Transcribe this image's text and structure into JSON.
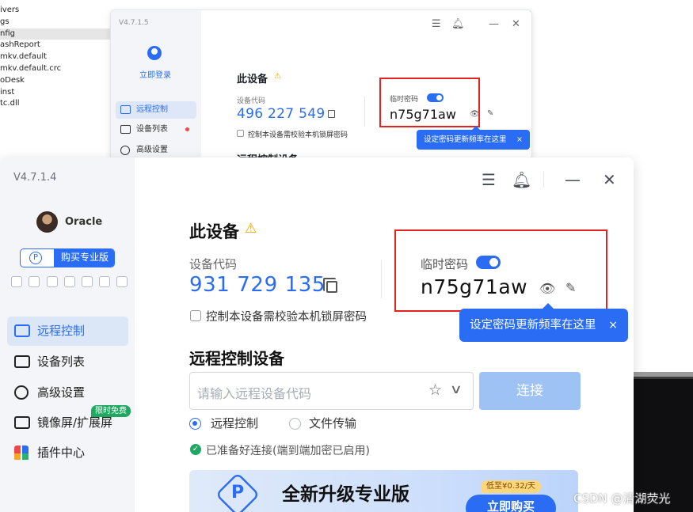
{
  "explorer": {
    "items": [
      "ivers",
      "gs",
      "nfig",
      "ashReport",
      "mkv.default",
      "mkv.default.crc",
      "oDesk",
      "inst",
      "tc.dll"
    ]
  },
  "back_window": {
    "version": "V4.7.1.5",
    "login": "立即登录",
    "nav": [
      "远程控制",
      "设备列表",
      "高级设置"
    ],
    "top_icons": [
      "menu-icon",
      "bell-icon",
      "minimize-icon",
      "close-icon"
    ],
    "title": "此设备",
    "code_label": "设备代码",
    "code": "496 227 549",
    "checkbox_label": "控制本设备需校验本机锁屏密码",
    "pw_label": "临时密码",
    "pw": "n75g71aw",
    "tooltip": "设定密码更新频率在这里",
    "tooltip_close": "×",
    "section_partial": "远程控制设备"
  },
  "main_window": {
    "version": "V4.7.1.4",
    "username": "Oracle",
    "pro_button": {
      "icon": "P",
      "label": "购买专业版"
    },
    "nav": [
      {
        "label": "远程控制",
        "icon": "monitor-icon",
        "active": true
      },
      {
        "label": "设备列表",
        "icon": "devices-icon",
        "active": false
      },
      {
        "label": "高级设置",
        "icon": "settings-icon",
        "active": false
      },
      {
        "label": "镜像屏/扩展屏",
        "icon": "mirror-icon",
        "active": false
      },
      {
        "label": "插件中心",
        "icon": "plugins-icon",
        "active": false
      }
    ],
    "free_badge": "限时免费",
    "title": "此设备",
    "warn_icon": "⚠",
    "code_label": "设备代码",
    "code": "931 729 135",
    "checkbox_label": "控制本设备需校验本机锁屏密码",
    "pw_label": "临时密码",
    "pw": "n75g71aw",
    "tooltip": "设定密码更新频率在这里",
    "tooltip_close": "×",
    "section_title": "远程控制设备",
    "search_placeholder": "请输入远程设备代码",
    "connect_label": "连接",
    "radio_options": [
      {
        "label": "远程控制",
        "selected": true
      },
      {
        "label": "文件传输",
        "selected": false
      }
    ],
    "status_text": "已准备好连接(端到端加密已启用)",
    "banner": {
      "title": "全新升级专业版",
      "price_tag": "低至¥0.32/天",
      "buy_label": "立即购买"
    }
  },
  "watermark": "CSDN @清湖荧光",
  "colors": {
    "accent": "#2a6df4",
    "highlight_box": "#e52222",
    "free_badge": "#1fa862"
  }
}
